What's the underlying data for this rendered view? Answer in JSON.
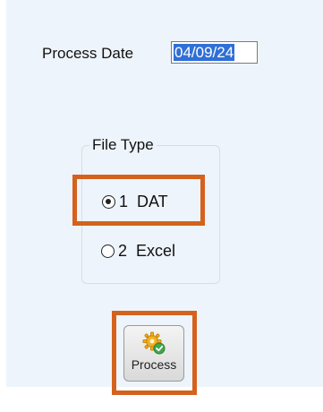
{
  "form": {
    "process_date_label": "Process Date",
    "process_date_value": "04/09/24"
  },
  "file_type": {
    "legend": "File Type",
    "options": [
      {
        "label": "1  DAT",
        "checked": true
      },
      {
        "label": "2  Excel",
        "checked": false
      }
    ]
  },
  "actions": {
    "process_label": "Process",
    "process_icon": "gear-check-icon"
  },
  "colors": {
    "panel_background": "#eef4fb",
    "highlight_border": "#d4621d",
    "selection": "#2f6fd6"
  }
}
